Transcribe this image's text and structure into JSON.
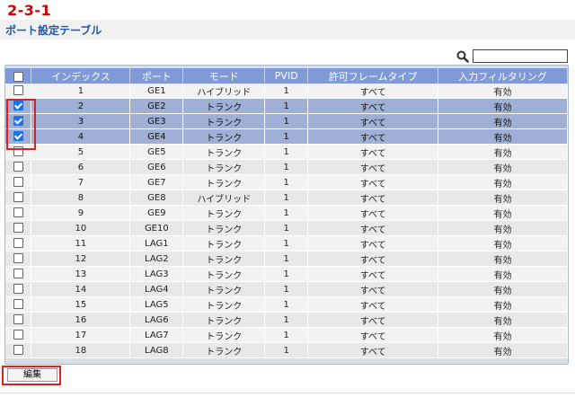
{
  "step_label": "2-3-1",
  "page_title": "ポート設定テーブル",
  "search": {
    "value": "",
    "placeholder": ""
  },
  "table": {
    "headers": [
      "",
      "インデックス",
      "ポート",
      "モード",
      "PVID",
      "許可フレームタイプ",
      "入力フィルタリング"
    ],
    "rows": [
      {
        "index": "1",
        "port": "GE1",
        "mode": "ハイブリッド",
        "pvid": "1",
        "frame": "すべて",
        "filter": "有効",
        "checked": false
      },
      {
        "index": "2",
        "port": "GE2",
        "mode": "トランク",
        "pvid": "1",
        "frame": "すべて",
        "filter": "有効",
        "checked": true
      },
      {
        "index": "3",
        "port": "GE3",
        "mode": "トランク",
        "pvid": "1",
        "frame": "すべて",
        "filter": "有効",
        "checked": true
      },
      {
        "index": "4",
        "port": "GE4",
        "mode": "トランク",
        "pvid": "1",
        "frame": "すべて",
        "filter": "有効",
        "checked": true
      },
      {
        "index": "5",
        "port": "GE5",
        "mode": "トランク",
        "pvid": "1",
        "frame": "すべて",
        "filter": "有効",
        "checked": false
      },
      {
        "index": "6",
        "port": "GE6",
        "mode": "トランク",
        "pvid": "1",
        "frame": "すべて",
        "filter": "有効",
        "checked": false
      },
      {
        "index": "7",
        "port": "GE7",
        "mode": "トランク",
        "pvid": "1",
        "frame": "すべて",
        "filter": "有効",
        "checked": false
      },
      {
        "index": "8",
        "port": "GE8",
        "mode": "ハイブリッド",
        "pvid": "1",
        "frame": "すべて",
        "filter": "有効",
        "checked": false
      },
      {
        "index": "9",
        "port": "GE9",
        "mode": "トランク",
        "pvid": "1",
        "frame": "すべて",
        "filter": "有効",
        "checked": false
      },
      {
        "index": "10",
        "port": "GE10",
        "mode": "トランク",
        "pvid": "1",
        "frame": "すべて",
        "filter": "有効",
        "checked": false
      },
      {
        "index": "11",
        "port": "LAG1",
        "mode": "トランク",
        "pvid": "1",
        "frame": "すべて",
        "filter": "有効",
        "checked": false
      },
      {
        "index": "12",
        "port": "LAG2",
        "mode": "トランク",
        "pvid": "1",
        "frame": "すべて",
        "filter": "有効",
        "checked": false
      },
      {
        "index": "13",
        "port": "LAG3",
        "mode": "トランク",
        "pvid": "1",
        "frame": "すべて",
        "filter": "有効",
        "checked": false
      },
      {
        "index": "14",
        "port": "LAG4",
        "mode": "トランク",
        "pvid": "1",
        "frame": "すべて",
        "filter": "有効",
        "checked": false
      },
      {
        "index": "15",
        "port": "LAG5",
        "mode": "トランク",
        "pvid": "1",
        "frame": "すべて",
        "filter": "有効",
        "checked": false
      },
      {
        "index": "16",
        "port": "LAG6",
        "mode": "トランク",
        "pvid": "1",
        "frame": "すべて",
        "filter": "有効",
        "checked": false
      },
      {
        "index": "17",
        "port": "LAG7",
        "mode": "トランク",
        "pvid": "1",
        "frame": "すべて",
        "filter": "有効",
        "checked": false
      },
      {
        "index": "18",
        "port": "LAG8",
        "mode": "トランク",
        "pvid": "1",
        "frame": "すべて",
        "filter": "有効",
        "checked": false
      }
    ]
  },
  "edit_button_label": "編集",
  "colors": {
    "step_red": "#d40000",
    "title_blue": "#1f5aa8",
    "header_blue": "#7f9ad6",
    "selected_row": "#9fafd6",
    "highlight_red": "#e02020"
  }
}
